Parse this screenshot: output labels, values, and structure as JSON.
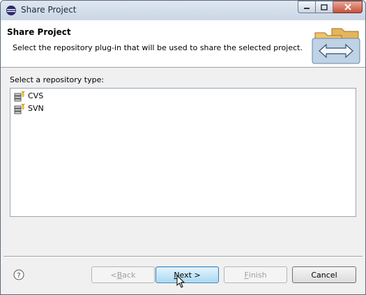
{
  "window": {
    "title": "Share Project"
  },
  "header": {
    "title": "Share Project",
    "description": "Select the repository plug-in that will be used to share the selected project."
  },
  "repository": {
    "label": "Select a repository type:",
    "items": [
      {
        "label": "CVS",
        "icon": "repository-icon"
      },
      {
        "label": "SVN",
        "icon": "repository-icon"
      }
    ]
  },
  "buttons": {
    "back": {
      "pre": "< ",
      "mnemonic": "B",
      "rest": "ack"
    },
    "next": {
      "mnemonic": "N",
      "rest": "ext >"
    },
    "finish": {
      "mnemonic": "F",
      "rest": "inish"
    },
    "cancel": "Cancel"
  },
  "colors": {
    "default_button": "#a9d9f2",
    "close_button": "#c7513c",
    "titlebar": "#c9d6e5"
  }
}
